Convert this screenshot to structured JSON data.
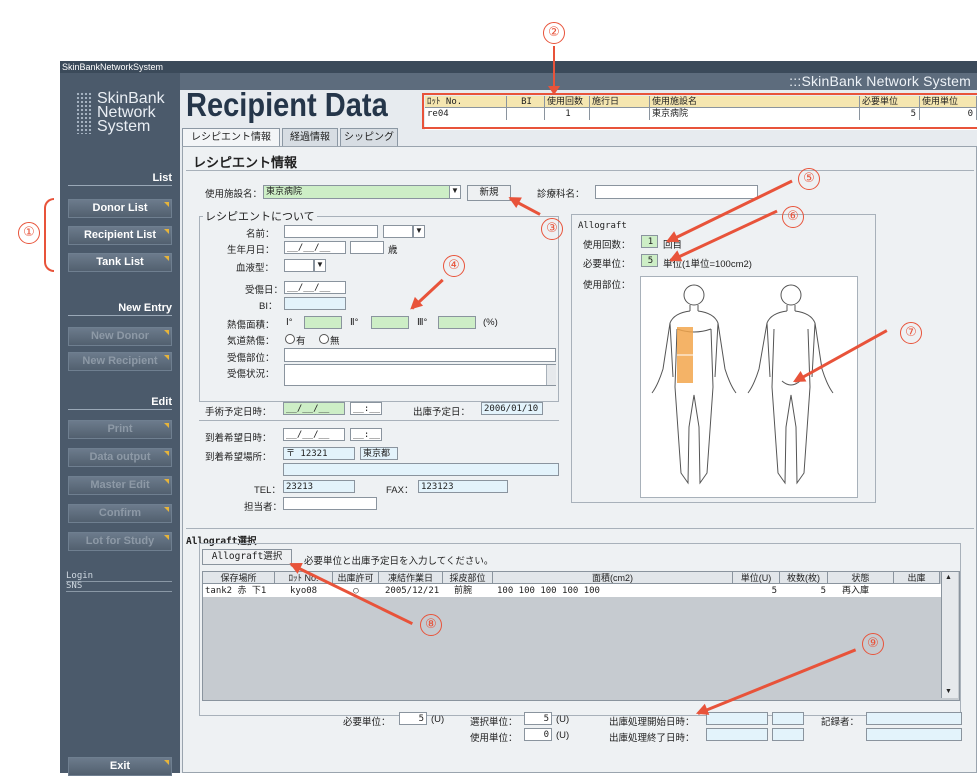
{
  "window_title": "SkinBankNetworkSystem",
  "top_logo": ":::SkinBank Network System",
  "brand": {
    "line1": "SkinBank",
    "line2": "Network",
    "line3": "System"
  },
  "page_title": "Recipient Data",
  "header_table": {
    "headers": [
      "ﾛｯﾄ No.",
      "BI",
      "使用回数",
      "施行日",
      "使用施設名",
      "必要単位",
      "使用単位"
    ],
    "row": [
      "re04",
      "",
      "1",
      "",
      "東京病院",
      "5",
      "0"
    ]
  },
  "tabs": [
    "レシピエント情報",
    "経過情報",
    "シッピング"
  ],
  "section_title": "レシピエント情報",
  "facility": {
    "label": "使用施設名：",
    "value": "東京病院",
    "new_button": "新規",
    "dept_label": "診療科名："
  },
  "about": {
    "title": "レシピエントについて",
    "name_label": "名前：",
    "dob_label": "生年月日：",
    "dob_value": "__/__/__",
    "age_unit": "歳",
    "blood_label": "血液型：",
    "injury_date_label": "受傷日：",
    "injury_date_value": "__/__/__",
    "bi_label": "BI：",
    "burn_area_label": "熱傷面積：",
    "deg1": "Ⅰ°",
    "deg2": "Ⅱ°",
    "deg3": "Ⅲ°",
    "pct": "(%)",
    "airway_label": "気道熱傷：",
    "airway_yes": "有",
    "airway_no": "無",
    "site_label": "受傷部位：",
    "status_label": "受傷状況："
  },
  "surgery": {
    "label": "手術予定日時：",
    "date": "__/__/__",
    "time": "__:__",
    "ship_label": "出庫予定日：",
    "ship_value": "2006/01/10"
  },
  "arrival": {
    "label": "到着希望日時：",
    "date": "__/__/__",
    "time": "__:__",
    "place_label": "到着希望場所：",
    "zip": "〒 12321",
    "pref": "東京都",
    "tel_label": "TEL：",
    "tel": "23213",
    "fax_label": "FAX：",
    "fax": "123123",
    "staff_label": "担当者："
  },
  "allograft": {
    "title": "Allograft",
    "uses_label": "使用回数：",
    "uses_value": "1",
    "uses_unit": "回目",
    "need_label": "必要単位：",
    "need_value": "5",
    "need_unit": "単位(1単位=100cm2)",
    "site_label": "使用部位："
  },
  "sidebar": {
    "list_title": "List",
    "list_items": [
      "Donor List",
      "Recipient List",
      "Tank List"
    ],
    "new_title": "New Entry",
    "new_items": [
      "New Donor",
      "New Recipient"
    ],
    "edit_title": "Edit",
    "edit_items": [
      "Print",
      "Data output",
      "Master Edit",
      "Confirm",
      "Lot for Study"
    ],
    "login_label": "Login",
    "login_user": "SNS",
    "exit": "Exit"
  },
  "selection": {
    "title": "Allograft選択",
    "button": "Allograft選択",
    "instruction": "必要単位と出庫予定日を入力してください。",
    "columns": [
      "保存場所",
      "ﾛｯﾄ No.",
      "出庫許可",
      "凍結作業日",
      "採皮部位",
      "面積(cm2)",
      "単位(U)",
      "枚数(枚)",
      "状態",
      "出庫"
    ],
    "row": [
      "tank2 赤 下1",
      "kyo08",
      "○",
      "2005/12/21",
      "前腕",
      "100 100 100 100 100",
      "5",
      "5",
      "再入庫",
      ""
    ],
    "need_label": "必要単位：",
    "need_value": "5",
    "unit": "(U)",
    "select_label": "選択単位：",
    "select_value": "5",
    "use_label": "使用単位：",
    "use_value": "0",
    "start_label": "出庫処理開始日時：",
    "end_label": "出庫処理終了日時：",
    "recorder_label": "記録者："
  },
  "callouts": [
    "①",
    "②",
    "③",
    "④",
    "⑤",
    "⑥",
    "⑦",
    "⑧",
    "⑨"
  ],
  "colors": {
    "sidebar": "#4b5a6b",
    "accent": "#e8533a",
    "header_fill": "#f5e6b0",
    "green_field": "#cdeec6",
    "blue_field": "#e3f3fb"
  }
}
